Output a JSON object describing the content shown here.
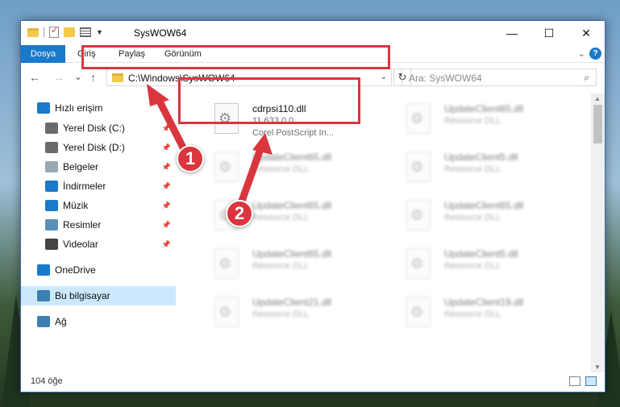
{
  "window": {
    "title": "SysWOW64",
    "controls": {
      "minimize": "—",
      "maximize": "☐",
      "close": "✕"
    }
  },
  "ribbon": {
    "tabs": [
      "Dosya",
      "Giriş",
      "Paylaş",
      "Görünüm"
    ],
    "expand_icon": "chevron-down-icon",
    "help_icon": "?"
  },
  "nav": {
    "back": "←",
    "forward": "→",
    "recent": "⌄",
    "up": "↑",
    "address": "C:\\Windows\\SysWOW64",
    "refresh": "↻",
    "search_placeholder": "Ara: SysWOW64",
    "search_icon": "⌕"
  },
  "sidebar": {
    "items": [
      {
        "label": "Hızlı erişim",
        "icon": "star-icon",
        "color": "#1979ca",
        "pinned": false
      },
      {
        "label": "Yerel Disk (C:)",
        "icon": "drive-icon",
        "color": "#6b6b6b",
        "pinned": true
      },
      {
        "label": "Yerel Disk (D:)",
        "icon": "drive-icon",
        "color": "#6b6b6b",
        "pinned": true
      },
      {
        "label": "Belgeler",
        "icon": "documents-icon",
        "color": "#9aa7b5",
        "pinned": true
      },
      {
        "label": "İndirmeler",
        "icon": "download-icon",
        "color": "#1979ca",
        "pinned": true
      },
      {
        "label": "Müzik",
        "icon": "music-icon",
        "color": "#1979ca",
        "pinned": true
      },
      {
        "label": "Resimler",
        "icon": "pictures-icon",
        "color": "#5b8fb8",
        "pinned": true
      },
      {
        "label": "Videolar",
        "icon": "videos-icon",
        "color": "#444444",
        "pinned": true
      },
      {
        "label": "OneDrive",
        "icon": "cloud-icon",
        "color": "#1979ca",
        "pinned": false
      },
      {
        "label": "Bu bilgisayar",
        "icon": "computer-icon",
        "color": "#3c7fb1",
        "pinned": false
      },
      {
        "label": "Ağ",
        "icon": "network-icon",
        "color": "#3c7fb1",
        "pinned": false
      }
    ],
    "pin_glyph": "📌"
  },
  "files": [
    {
      "name": "cdrpsi110.dll",
      "line2": "11.633.0.0",
      "line3": "Corel PostScript In...",
      "blurred": false
    },
    {
      "name": "UpdateClient65.dll",
      "line2": "Resource DLL",
      "blurred": true
    },
    {
      "name": "UpdateClient65.dll",
      "line2": "Resource DLL",
      "blurred": true
    },
    {
      "name": "UpdateClient5.dll",
      "line2": "Resource DLL",
      "blurred": true
    },
    {
      "name": "UpdateClient65.dll",
      "line2": "Resource DLL",
      "blurred": true
    },
    {
      "name": "UpdateClient65.dll",
      "line2": "Resource DLL",
      "blurred": true
    },
    {
      "name": "UpdateClient65.dll",
      "line2": "Resource DLL",
      "blurred": true
    },
    {
      "name": "UpdateClient5.dll",
      "line2": "Resource DLL",
      "blurred": true
    },
    {
      "name": "UpdateClient21.dll",
      "line2": "Resource DLL",
      "blurred": true
    },
    {
      "name": "UpdateClient19.dll",
      "line2": "Resource DLL",
      "blurred": true
    }
  ],
  "status": {
    "count": "104 öğe"
  },
  "annotations": {
    "marker1": "1",
    "marker2": "2",
    "highlight_color": "#d9363e"
  }
}
